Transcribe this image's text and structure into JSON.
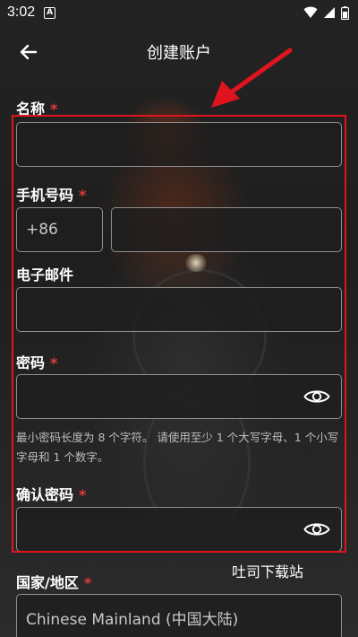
{
  "status_bar": {
    "time": "3:02",
    "notification_icon": "A"
  },
  "header": {
    "title": "创建账户"
  },
  "form": {
    "name": {
      "label": "名称",
      "required": "*"
    },
    "phone": {
      "label": "手机号码",
      "required": "*",
      "country_code": "+86"
    },
    "email": {
      "label": "电子邮件"
    },
    "password": {
      "label": "密码",
      "required": "*"
    },
    "password_hint": "最小密码长度为 8 个字符。 请使用至少 1 个大写字母、1 个小写字母和 1 个数字。",
    "confirm_password": {
      "label": "确认密码",
      "required": "*"
    },
    "country": {
      "label": "国家/地区",
      "required": "*",
      "value": "Chinese Mainland (中国大陆)"
    }
  },
  "overlay": {
    "watermark": "吐司下载站",
    "highlight_color": "#e0141e"
  },
  "icons": {
    "back": "arrow-left-icon",
    "eye": "eye-icon",
    "wifi": "wifi-icon",
    "signal": "signal-icon",
    "battery": "battery-icon"
  },
  "colors": {
    "required_mark": "#e23a3a",
    "field_border": "#8e8e8e"
  }
}
